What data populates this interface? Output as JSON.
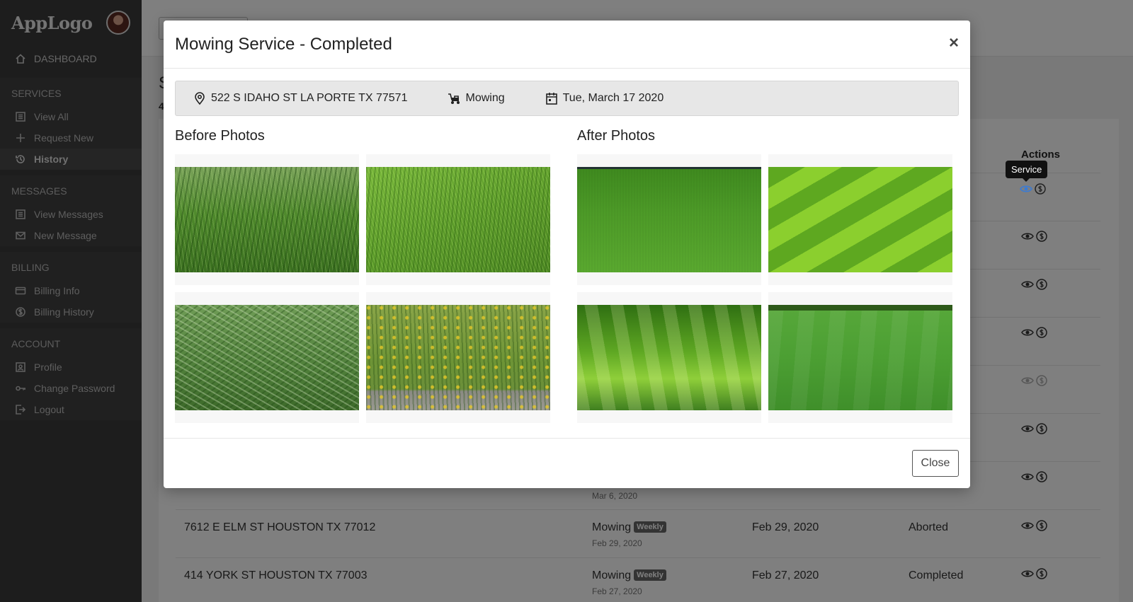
{
  "sidebar": {
    "logo": "AppLogo",
    "dashboard": "DASHBOARD",
    "sections": [
      {
        "title": "SERVICES",
        "items": [
          {
            "label": "View All",
            "icon": "list-icon"
          },
          {
            "label": "Request New",
            "icon": "plus-icon"
          },
          {
            "label": "History",
            "icon": "history-icon",
            "active": true
          }
        ]
      },
      {
        "title": "MESSAGES",
        "items": [
          {
            "label": "View Messages",
            "icon": "list-icon"
          },
          {
            "label": "New Message",
            "icon": "envelope-icon"
          }
        ]
      },
      {
        "title": "BILLING",
        "items": [
          {
            "label": "Billing Info",
            "icon": "credit-card-icon"
          },
          {
            "label": "Billing History",
            "icon": "dollar-circle-icon"
          }
        ]
      },
      {
        "title": "ACCOUNT",
        "items": [
          {
            "label": "Profile",
            "icon": "profile-icon"
          },
          {
            "label": "Change Password",
            "icon": "key-icon"
          },
          {
            "label": "Logout",
            "icon": "logout-icon"
          }
        ]
      }
    ]
  },
  "background": {
    "page_letter": "S",
    "count_text": "4",
    "actions_header": "Actions",
    "rows": [
      {
        "address": "",
        "service": "",
        "badge": "",
        "sub_date": "Mar 6, 2020",
        "date": "",
        "status": ""
      },
      {
        "address": "7612 E ELM ST HOUSTON TX 77012",
        "service": "Mowing",
        "badge": "Weekly",
        "sub_date": "Feb 29, 2020",
        "date": "Feb 29, 2020",
        "status": "Aborted"
      },
      {
        "address": "414 YORK ST HOUSTON TX 77003",
        "service": "Mowing",
        "badge": "Weekly",
        "sub_date": "Feb 27, 2020",
        "date": "Feb 27, 2020",
        "status": "Completed"
      }
    ]
  },
  "tooltip": "Service",
  "modal": {
    "title": "Mowing Service - Completed",
    "close_x": "×",
    "address": "522 S IDAHO ST LA PORTE TX 77571",
    "service_type": "Mowing",
    "date": "Tue, March 17 2020",
    "before_title": "Before Photos",
    "after_title": "After Photos",
    "close_button": "Close"
  },
  "colors": {
    "sidebar_bg": "#3a3a3a",
    "highlight_icon": "#3a7bd5"
  }
}
